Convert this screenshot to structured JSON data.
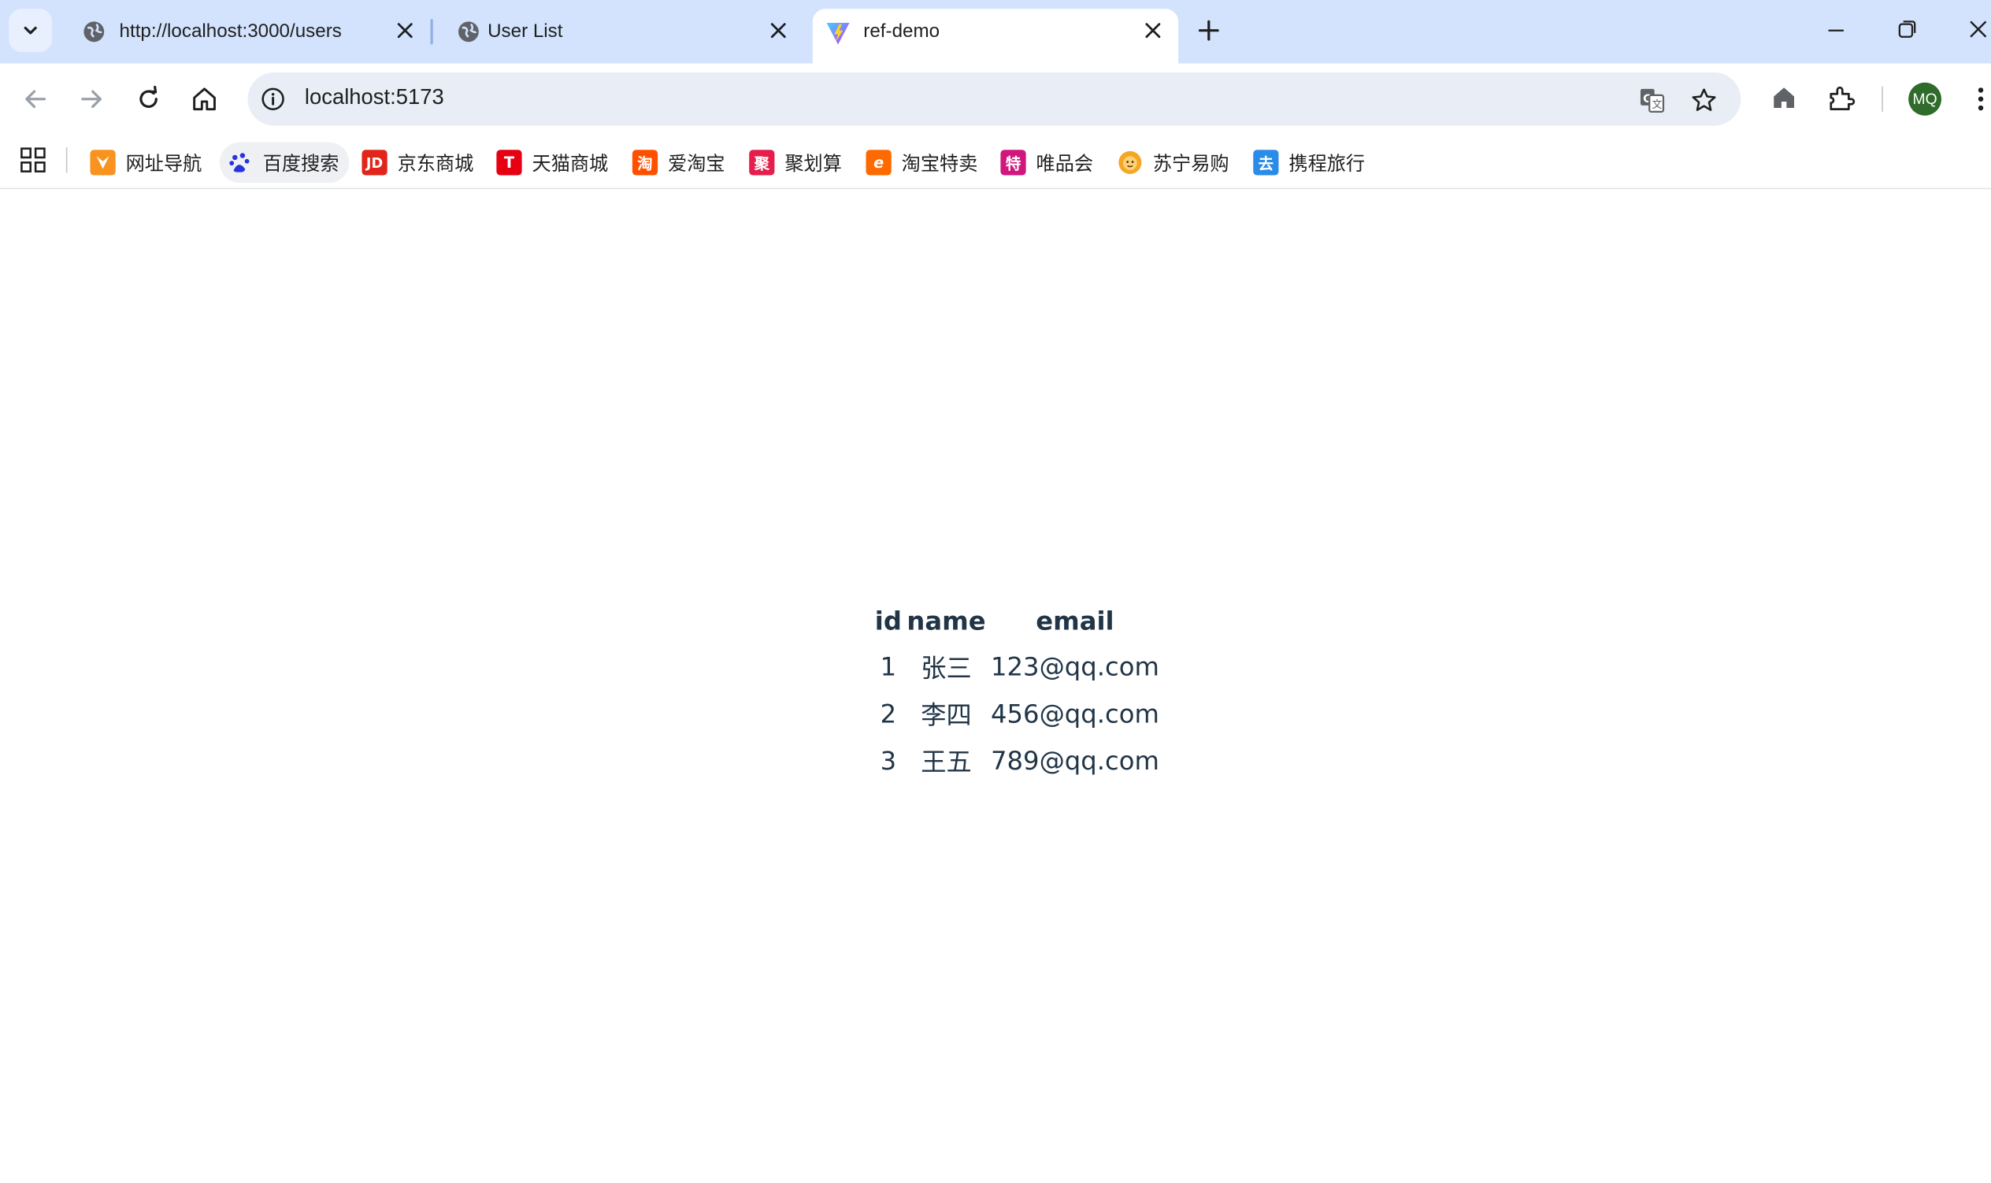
{
  "browser": {
    "tabs": [
      {
        "title": "http://localhost:3000/users",
        "icon": "globe-icon",
        "active": false
      },
      {
        "title": "User List",
        "icon": "globe-icon",
        "active": false
      },
      {
        "title": "ref-demo",
        "icon": "vite-logo-icon",
        "active": true
      }
    ],
    "address": "localhost:5173",
    "profile_initials": "MQ",
    "bookmarks": [
      {
        "label": "网址导航",
        "icon": "navigation-bookmark-icon",
        "color": "#f7931e",
        "glyph": ""
      },
      {
        "label": "百度搜索",
        "icon": "baidu-paw-icon",
        "color": "#2932e1",
        "glyph": ""
      },
      {
        "label": "京东商城",
        "icon": "jd-logo-icon",
        "color": "#e1251b",
        "glyph": "JD"
      },
      {
        "label": "天猫商城",
        "icon": "tmall-logo-icon",
        "color": "#e60012",
        "glyph": "T"
      },
      {
        "label": "爱淘宝",
        "icon": "taobao-logo-icon",
        "color": "#ff5000",
        "glyph": "淘"
      },
      {
        "label": "聚划算",
        "icon": "juhuasuan-logo-icon",
        "color": "#e61e4d",
        "glyph": "聚"
      },
      {
        "label": "淘宝特卖",
        "icon": "taobao-sale-icon",
        "color": "#ff6a00",
        "glyph": "e"
      },
      {
        "label": "唯品会",
        "icon": "vip-logo-icon",
        "color": "#d1177d",
        "glyph": "特"
      },
      {
        "label": "苏宁易购",
        "icon": "suning-lion-icon",
        "color": "#f5a623",
        "glyph": ""
      },
      {
        "label": "携程旅行",
        "icon": "ctrip-logo-icon",
        "color": "#2b8ce8",
        "glyph": "去"
      }
    ]
  },
  "users_table": {
    "headers": [
      "id",
      "name",
      "email"
    ],
    "rows": [
      {
        "id": "1",
        "name": "张三",
        "email": "123@qq.com"
      },
      {
        "id": "2",
        "name": "李四",
        "email": "456@qq.com"
      },
      {
        "id": "3",
        "name": "王五",
        "email": "789@qq.com"
      }
    ]
  }
}
